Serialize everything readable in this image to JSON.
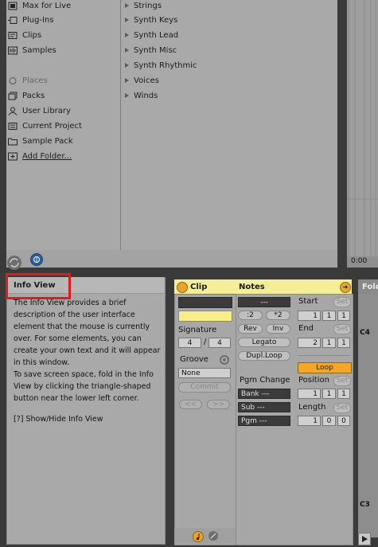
{
  "browser": {
    "places": [
      {
        "label": "Max for Live",
        "icon": "max-icon"
      },
      {
        "label": "Plug-Ins",
        "icon": "plugin-icon"
      },
      {
        "label": "Clips",
        "icon": "clip-icon"
      },
      {
        "label": "Samples",
        "icon": "waveform-icon"
      }
    ],
    "places_heading": "Places",
    "locations": [
      {
        "label": "Packs",
        "icon": "packs-icon"
      },
      {
        "label": "User Library",
        "icon": "user-icon"
      },
      {
        "label": "Current Project",
        "icon": "project-icon"
      },
      {
        "label": "Sample Pack",
        "icon": "folder-icon"
      },
      {
        "label": "Add Folder...",
        "icon": "add-folder-icon"
      }
    ],
    "categories": [
      "Strings",
      "Synth Keys",
      "Synth Lead",
      "Synth Misc",
      "Synth Rhythmic",
      "Voices",
      "Winds"
    ]
  },
  "arrangement": {
    "time_label": "0:00"
  },
  "info_view": {
    "title": "Info View",
    "paragraph1": "The Info View provides a brief description of the user interface element that the mouse is currently over. For some elements, you can create your own text and it will appear in this window.",
    "paragraph2": "To save screen space, fold in the Info View by clicking the triangle-shaped button near the lower left corner.",
    "link": "[?] Show/Hide Info View"
  },
  "clip": {
    "title": "Clip",
    "signature_label": "Signature",
    "sig_num": "4",
    "sig_sep": "/",
    "sig_den": "4",
    "groove_label": "Groove",
    "groove_value": "None",
    "commit_label": "Commit",
    "nav_prev": "<<",
    "nav_next": ">>"
  },
  "notes": {
    "title": "Notes",
    "dash_field": "---",
    "half_label": ":2",
    "double_label": "*2",
    "rev_label": "Rev",
    "inv_label": "Inv",
    "legato_label": "Legato",
    "dupl_label": "Dupl.Loop",
    "pgm_change_label": "Pgm Change",
    "bank": "Bank ---",
    "sub": "Sub ---",
    "pgm": "Pgm ---",
    "start_label": "Start",
    "start": [
      "1",
      "1",
      "1"
    ],
    "end_label": "End",
    "end": [
      "2",
      "1",
      "1"
    ],
    "loop_label": "Loop",
    "position_label": "Position",
    "position": [
      "1",
      "1",
      "1"
    ],
    "length_label": "Length",
    "length": [
      "1",
      "0",
      "0"
    ],
    "set_label": "Set"
  },
  "piano_roll": {
    "fold_label": "Fold",
    "key_c4": "C4",
    "key_c3": "C3"
  },
  "colors": {
    "clip_header": "#f4ee96",
    "toggle_orange": "#e9a52a",
    "loop_orange": "#f5a623",
    "highlight_red": "#e01b1b"
  }
}
